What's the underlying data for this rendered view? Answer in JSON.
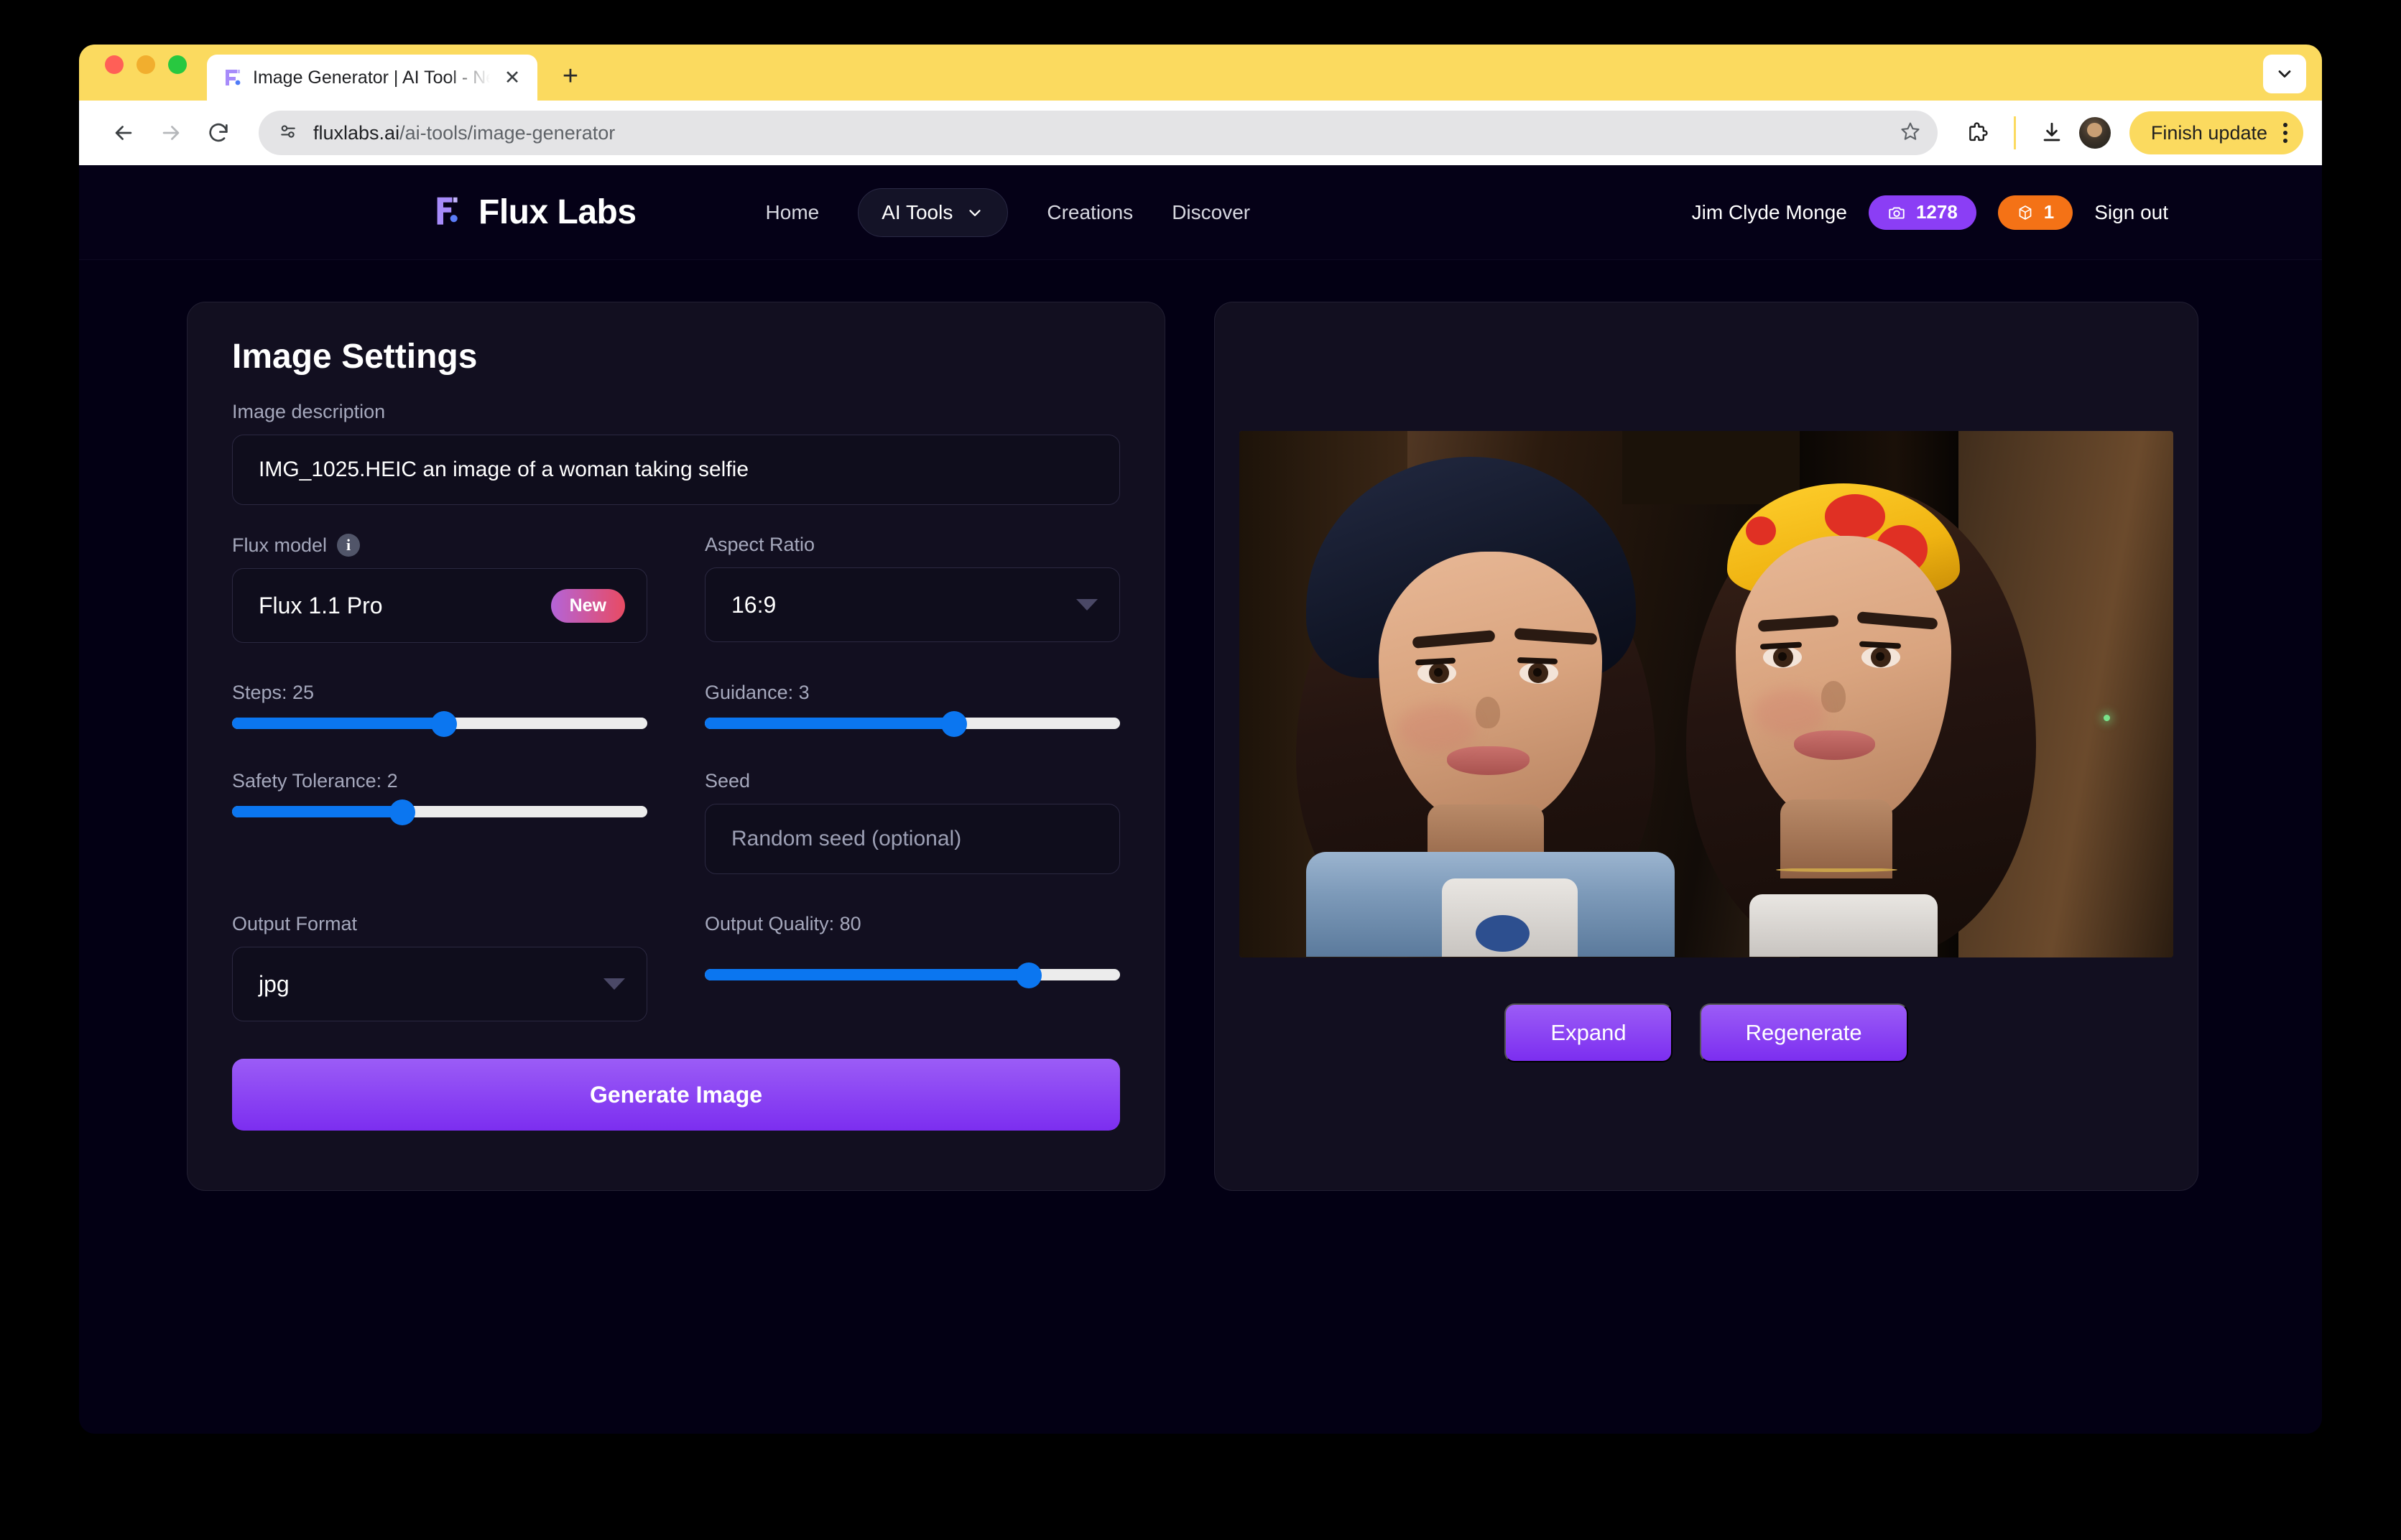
{
  "browser": {
    "tab": {
      "title": "Image Generator | AI Tool - Ne",
      "favicon_name": "flux-labs-favicon",
      "close_label": "✕",
      "new_tab_label": "+"
    },
    "toolbar": {
      "back_label": "←",
      "forward_label": "→",
      "reload_label": "↻",
      "url_host": "fluxlabs.ai",
      "url_path": "/ai-tools/image-generator",
      "star_label": "☆",
      "finish_update_label": "Finish update"
    }
  },
  "header": {
    "brand": "Flux Labs",
    "nav": [
      {
        "label": "Home"
      },
      {
        "label": "AI Tools"
      },
      {
        "label": "Creations"
      },
      {
        "label": "Discover"
      }
    ],
    "user_name": "Jim Clyde Monge",
    "credits": [
      {
        "icon": "camera-icon",
        "value": "1278",
        "color": "#8B3EF5"
      },
      {
        "icon": "cube-icon",
        "value": "1",
        "color": "#F47216"
      }
    ],
    "sign_out": "Sign out"
  },
  "settings": {
    "title": "Image Settings",
    "description_label": "Image description",
    "description_value": "IMG_1025.HEIC an image of a woman taking selfie",
    "flux_model_label": "Flux model",
    "flux_model_value": "Flux 1.1 Pro",
    "flux_model_badge": "New",
    "aspect_ratio_label": "Aspect Ratio",
    "aspect_ratio_value": "16:9",
    "steps_label": "Steps: 25",
    "steps_percent": 51,
    "guidance_label": "Guidance: 3",
    "guidance_percent": 60,
    "safety_label": "Safety Tolerance: 2",
    "safety_percent": 41,
    "seed_label": "Seed",
    "seed_placeholder": "Random seed (optional)",
    "output_format_label": "Output Format",
    "output_format_value": "jpg",
    "output_quality_label": "Output Quality: 80",
    "output_quality_percent": 78,
    "generate_label": "Generate Image"
  },
  "preview": {
    "image_alt": "two-women-selfie-generated-image",
    "expand_label": "Expand",
    "regenerate_label": "Regenerate"
  },
  "colors": {
    "page_bg": "#030014",
    "card_bg": "#120F20",
    "accent_purple": "#7C2EF0",
    "slider_blue": "#0B76F0",
    "tab_yellow": "#FBDA5F",
    "credit_purple": "#8B3EF5",
    "credit_orange": "#F47216"
  }
}
